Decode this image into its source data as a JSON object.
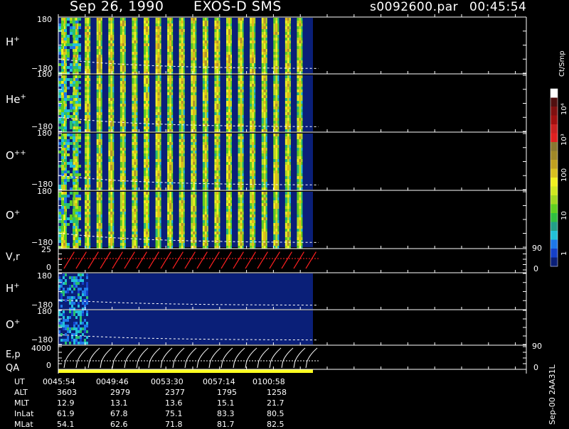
{
  "header": {
    "date": "Sep 26, 1990",
    "mission": "EXOS-D SMS",
    "file": "s0092600.par",
    "time": "00:45:54"
  },
  "colors": {
    "background": "#000000",
    "data_field": "#0a1f78",
    "axis": "#ffffff",
    "velocity_trace": "#ff2020",
    "qa_bar": "#ffff20"
  },
  "panels": [
    {
      "id": "h_plus",
      "label": "H",
      "sup": "+",
      "ytop": "180",
      "ybot": "−180"
    },
    {
      "id": "he_plus",
      "label": "He",
      "sup": "+",
      "ytop": "180",
      "ybot": "−180"
    },
    {
      "id": "o_pp",
      "label": "O",
      "sup": "++",
      "ytop": "180",
      "ybot": "−180"
    },
    {
      "id": "o_plus",
      "label": "O",
      "sup": "+",
      "ytop": "180",
      "ybot": "−180"
    },
    {
      "id": "v_r",
      "label": "V,r",
      "sup": "",
      "ytop": "25",
      "ybot": "0",
      "rtop": "90",
      "rbot": "0"
    },
    {
      "id": "h_plus2",
      "label": "H",
      "sup": "+",
      "ytop": "180",
      "ybot": "−180"
    },
    {
      "id": "o_plus2",
      "label": "O",
      "sup": "+",
      "ytop": "180",
      "ybot": "−180"
    },
    {
      "id": "ep_qa",
      "label": "E,p",
      "label2": "QA",
      "sup": "",
      "ytop": "4000",
      "ybot": "0",
      "rtop": "90",
      "rbot": "0"
    }
  ],
  "colorbar": {
    "title": "Ct/Smp",
    "ticks": [
      "10⁴",
      "10³",
      "100",
      "10",
      "1"
    ]
  },
  "side_label": "Sep-00 2AA31L",
  "ephemeris": {
    "rows": [
      {
        "name": "UT",
        "values": [
          "0045:54",
          "0049:46",
          "0053:30",
          "0057:14",
          "0100:58"
        ]
      },
      {
        "name": "ALT",
        "values": [
          "3603",
          "2979",
          "2377",
          "1795",
          "1258"
        ]
      },
      {
        "name": "MLT",
        "values": [
          "12.9",
          "13.1",
          "13.6",
          "15.1",
          "21.7"
        ]
      },
      {
        "name": "InLat",
        "values": [
          "61.9",
          "67.8",
          "75.1",
          "83.3",
          "80.5"
        ]
      },
      {
        "name": "MLat",
        "values": [
          "54.1",
          "62.6",
          "71.8",
          "81.7",
          "82.5"
        ]
      }
    ]
  },
  "chart_data": {
    "type": "heatmap",
    "title": "Sep 26, 1990   EXOS-D SMS",
    "x": [
      "0045:54",
      "0049:46",
      "0053:30",
      "0057:14",
      "0100:58"
    ],
    "xlabel": "UT",
    "data_end_ut": "0103:00",
    "panels": [
      {
        "name": "H+",
        "ylim": [
          -180,
          180
        ],
        "stripes": 21
      },
      {
        "name": "He+",
        "ylim": [
          -180,
          180
        ],
        "stripes": 21
      },
      {
        "name": "O++",
        "ylim": [
          -180,
          180
        ],
        "stripes": 21
      },
      {
        "name": "O+",
        "ylim": [
          -180,
          180
        ],
        "stripes": 21
      },
      {
        "name": "V,r",
        "ylim": [
          0,
          25
        ],
        "right_ylim": [
          0,
          90
        ]
      },
      {
        "name": "H+",
        "ylim": [
          -180,
          180
        ]
      },
      {
        "name": "O+",
        "ylim": [
          -180,
          180
        ]
      },
      {
        "name": "E,p",
        "ylim": [
          0,
          4000
        ],
        "right_ylim": [
          0,
          90
        ]
      }
    ],
    "colorbar": {
      "label": "Ct/Smp",
      "scale": "log",
      "range": [
        1,
        10000
      ],
      "ticks": [
        "1",
        "10",
        "100",
        "10³",
        "10⁴"
      ]
    }
  }
}
